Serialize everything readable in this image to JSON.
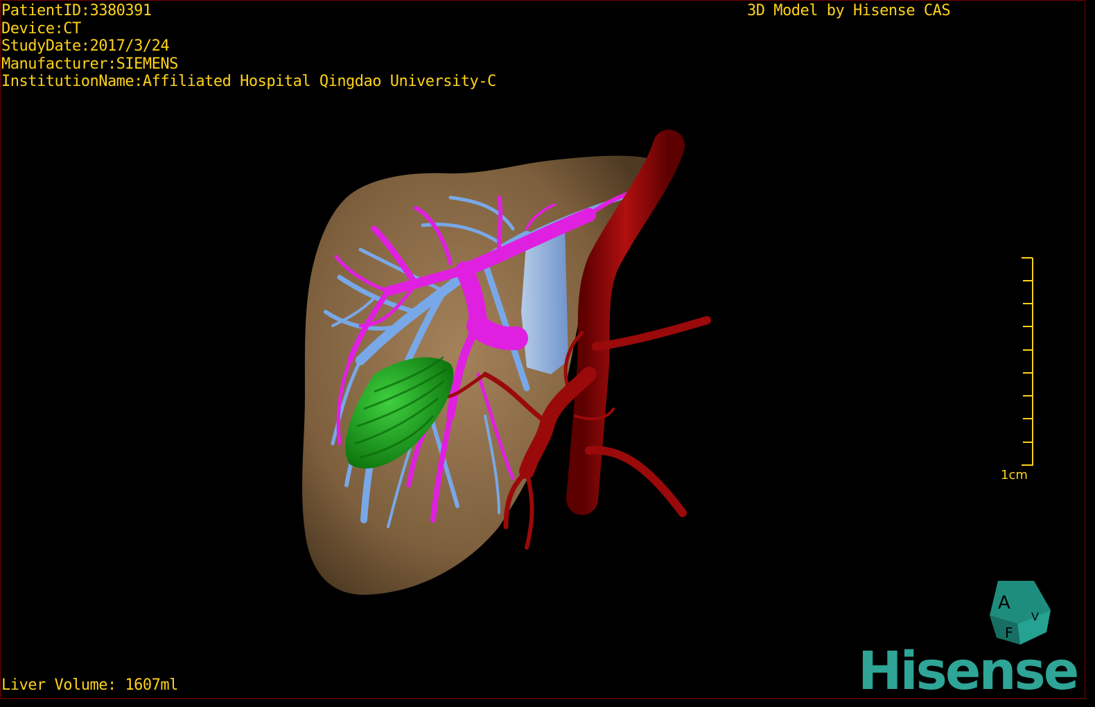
{
  "header": {
    "patient_id": "PatientID:3380391",
    "device": "Device:CT",
    "study_date": "StudyDate:2017/3/24",
    "manufacturer": "Manufacturer:SIEMENS",
    "institution": "InstitutionName:Affiliated Hospital Qingdao University-C"
  },
  "credit": "3D Model by Hisense CAS",
  "footer": {
    "liver_volume": "Liver Volume: 1607ml"
  },
  "scale_bar": {
    "label": "1cm"
  },
  "orientation_cube": {
    "face_a": "A",
    "face_f": "F",
    "face_side": "V"
  },
  "logo": "Hisense",
  "colors": {
    "text": "#ffd21a",
    "liver": "#8c6c46",
    "portal_vein": "#e020e0",
    "hepatic_vein": "#78a8e8",
    "artery": "#9a0a0a",
    "tumor": "#1aa81a",
    "logo": "#2ea596"
  }
}
